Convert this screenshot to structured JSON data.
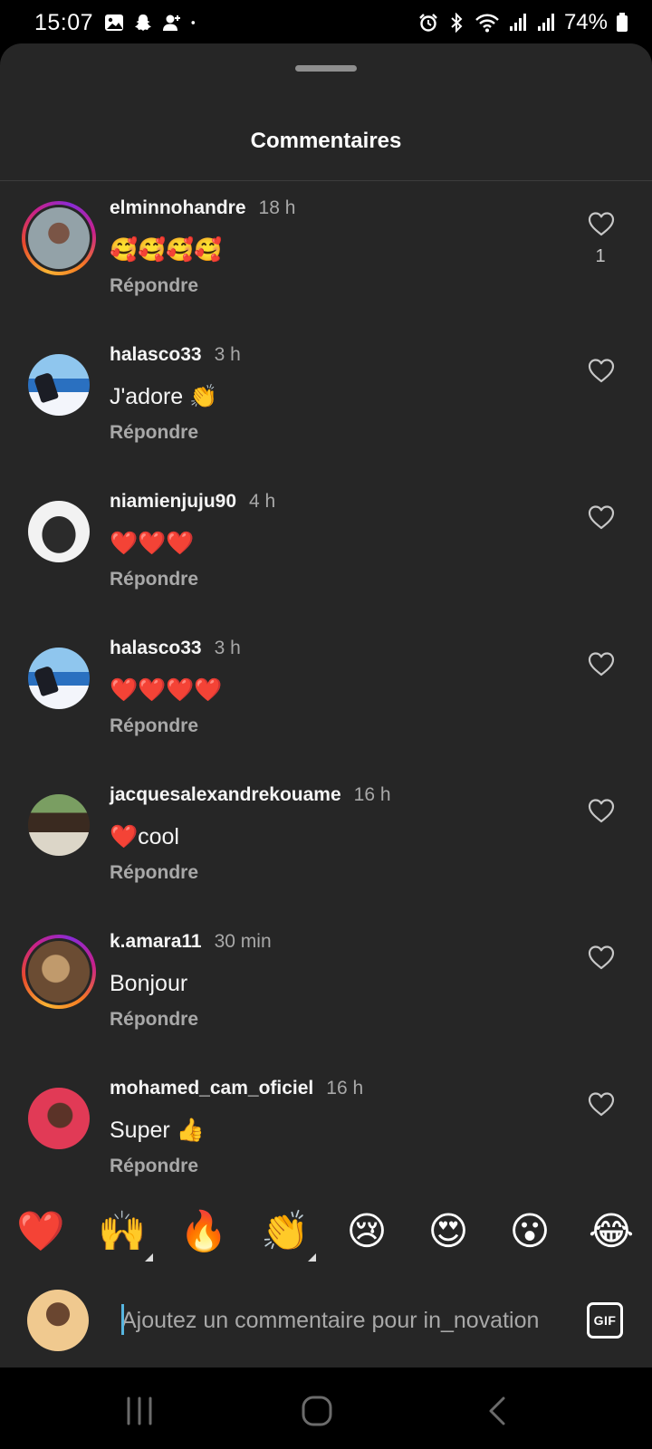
{
  "status_bar": {
    "time": "15:07",
    "battery": "74%",
    "left_icons": [
      "gallery-icon",
      "snapchat-icon",
      "contact-add-icon",
      "dot-icon"
    ],
    "right_icons": [
      "alarm-icon",
      "bluetooth-icon",
      "wifi-icon",
      "signal-icon",
      "signal-icon",
      "battery-icon"
    ]
  },
  "sheet": {
    "title": "Commentaires"
  },
  "comments": [
    {
      "username": "elminnohandre",
      "time": "18 h",
      "text": "🥰🥰🥰🥰",
      "reply": "Répondre",
      "likes": "1",
      "story_ring": true
    },
    {
      "username": "halasco33",
      "time": "3 h",
      "text": "J'adore 👏",
      "reply": "Répondre",
      "likes": "",
      "story_ring": false
    },
    {
      "username": "niamienjuju90",
      "time": "4 h",
      "text": "❤️❤️❤️",
      "reply": "Répondre",
      "likes": "",
      "story_ring": false
    },
    {
      "username": "halasco33",
      "time": "3 h",
      "text": "❤️❤️❤️❤️",
      "reply": "Répondre",
      "likes": "",
      "story_ring": false
    },
    {
      "username": "jacquesalexandrekouame",
      "time": "16 h",
      "text": "❤️cool",
      "reply": "Répondre",
      "likes": "",
      "story_ring": false
    },
    {
      "username": "k.amara11",
      "time": "30 min",
      "text": "Bonjour",
      "reply": "Répondre",
      "likes": "",
      "story_ring": true
    },
    {
      "username": "mohamed_cam_oficiel",
      "time": "16 h",
      "text": "Super 👍",
      "reply": "Répondre",
      "likes": "",
      "story_ring": false
    }
  ],
  "quick_reactions": [
    "❤️",
    "🙌",
    "🔥",
    "👏",
    "😢",
    "😍",
    "😮",
    "😂"
  ],
  "composer": {
    "placeholder": "Ajoutez un commentaire pour in_novation",
    "value": "",
    "gif_label": "GIF"
  },
  "colors": {
    "sheet_background": "#262626",
    "secondary_text": "#a8a8a8",
    "caret": "#57b6e0"
  }
}
